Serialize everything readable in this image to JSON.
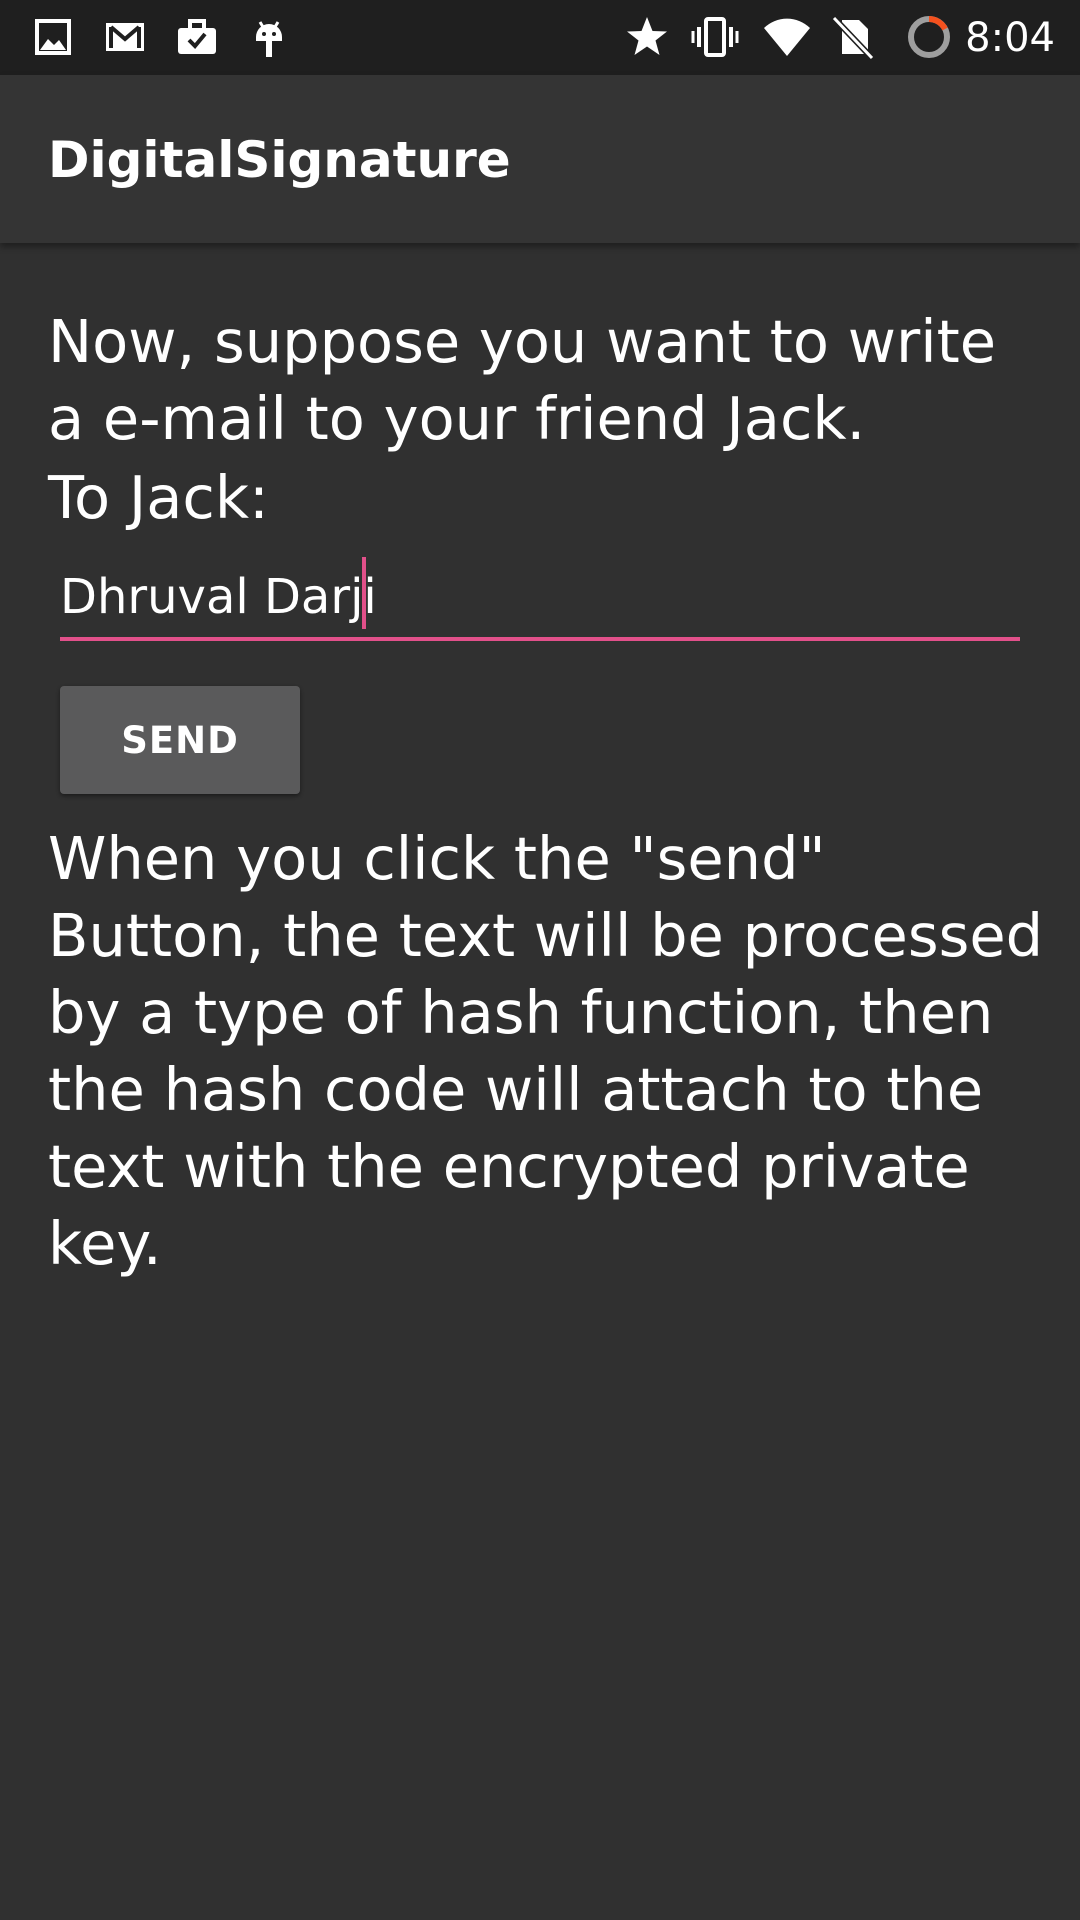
{
  "status_bar": {
    "time": "8:04",
    "left_icons": [
      "image-icon",
      "gmail-icon",
      "work-briefcase-icon",
      "android-debug-icon"
    ],
    "right_icons": [
      "star-icon",
      "vibrate-icon",
      "wifi-icon",
      "no-sim-icon",
      "battery-saver-icon"
    ]
  },
  "app_bar": {
    "title": "DigitalSignature"
  },
  "main": {
    "intro_text": "Now, suppose you want to write a e-mail to your friend Jack.",
    "to_label": "To Jack:",
    "message_input": {
      "value": "Dhruval Darji",
      "placeholder": ""
    },
    "send_button_label": "SEND",
    "info_text": "When you click the \"send\" Button, the text will be processed by a type of hash function, then the hash code will attach to the text with the encrypted private key."
  },
  "colors": {
    "accent": "#e2508a",
    "background": "#303030",
    "app_bar": "#343434",
    "status_bar": "#1f1f1f",
    "button": "#5a5a5b"
  }
}
